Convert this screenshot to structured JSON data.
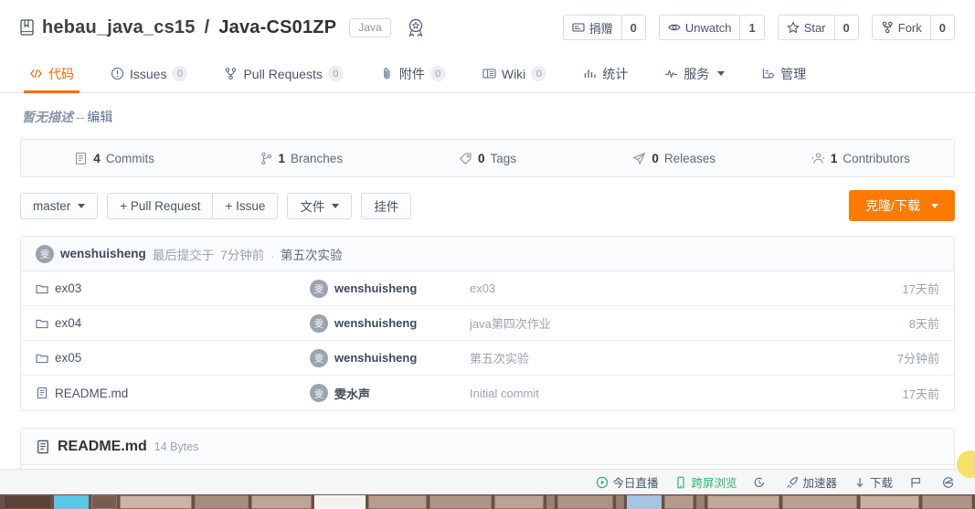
{
  "header": {
    "owner": "hebau_java_cs15",
    "separator": "/",
    "repo": "Java-CS01ZP",
    "language_badge": "Java",
    "medal_icon": "medal-icon",
    "book_icon": "repo-book-icon",
    "actions": [
      {
        "icon": "donate-icon",
        "label": "捐赠",
        "count": "0"
      },
      {
        "icon": "eye-icon",
        "label": "Unwatch",
        "count": "1"
      },
      {
        "icon": "star-icon",
        "label": "Star",
        "count": "0"
      },
      {
        "icon": "fork-icon",
        "label": "Fork",
        "count": "0"
      }
    ]
  },
  "nav": {
    "tabs": [
      {
        "icon": "code-icon",
        "label": "代码",
        "count": null,
        "active": true,
        "caret": false
      },
      {
        "icon": "issue-icon",
        "label": "Issues",
        "count": "0",
        "active": false,
        "caret": false
      },
      {
        "icon": "pull-request-icon",
        "label": "Pull Requests",
        "count": "0",
        "active": false,
        "caret": false
      },
      {
        "icon": "attachment-icon",
        "label": "附件",
        "count": "0",
        "active": false,
        "caret": false
      },
      {
        "icon": "wiki-icon",
        "label": "Wiki",
        "count": "0",
        "active": false,
        "caret": false
      },
      {
        "icon": "stats-icon",
        "label": "统计",
        "count": null,
        "active": false,
        "caret": false
      },
      {
        "icon": "service-icon",
        "label": "服务",
        "count": null,
        "active": false,
        "caret": true
      },
      {
        "icon": "manage-icon",
        "label": "管理",
        "count": null,
        "active": false,
        "caret": false
      }
    ]
  },
  "description": {
    "text": "暂无描述",
    "dash": "--",
    "edit_label": "编辑"
  },
  "stats": [
    {
      "icon": "commit-icon",
      "value": "4",
      "label": "Commits"
    },
    {
      "icon": "branch-icon",
      "value": "1",
      "label": "Branches"
    },
    {
      "icon": "tag-icon",
      "value": "0",
      "label": "Tags"
    },
    {
      "icon": "release-icon",
      "value": "0",
      "label": "Releases"
    },
    {
      "icon": "contributors-icon",
      "value": "1",
      "label": "Contributors"
    }
  ],
  "toolbar": {
    "branch_label": "master",
    "pull_request_label": "+ Pull Request",
    "issue_label": "+ Issue",
    "files_label": "文件",
    "widget_label": "挂件",
    "clone_label": "克隆/下载"
  },
  "last_commit": {
    "avatar_text": "雯",
    "author": "wenshuisheng",
    "meta": "最后提交于",
    "time": "7分钟前",
    "dot": ".",
    "message": "第五次实验"
  },
  "files": [
    {
      "icon": "folder-icon",
      "name": "ex03",
      "avatar_text": "雯",
      "author": "wenshuisheng",
      "message": "ex03",
      "time": "17天前"
    },
    {
      "icon": "folder-icon",
      "name": "ex04",
      "avatar_text": "雯",
      "author": "wenshuisheng",
      "message": "java第四次作业",
      "time": "8天前"
    },
    {
      "icon": "folder-icon",
      "name": "ex05",
      "avatar_text": "雯",
      "author": "wenshuisheng",
      "message": "第五次实验",
      "time": "7分钟前"
    },
    {
      "icon": "file-icon",
      "name": "README.md",
      "avatar_text": "雯",
      "author": "雯水声",
      "message": "Initial commit",
      "time": "17天前"
    }
  ],
  "readme": {
    "icon": "readme-file-icon",
    "title": "README.md",
    "size": "14 Bytes"
  },
  "statusbar": {
    "items": [
      {
        "icon": "play-circle-icon",
        "label": "今日直播",
        "accent": true
      },
      {
        "icon": "phone-icon",
        "label": "跨屏浏览",
        "accent": true
      },
      {
        "icon": "history-icon",
        "label": "",
        "accent": false
      },
      {
        "icon": "rocket-icon",
        "label": "加速器",
        "accent": false
      },
      {
        "icon": "download-arrow-icon",
        "label": "下载",
        "accent": false
      },
      {
        "icon": "flag-icon",
        "label": "",
        "accent": false
      },
      {
        "icon": "browser-e-icon",
        "label": "",
        "accent": false
      }
    ]
  },
  "colors": {
    "accent_orange": "#ff6a00",
    "clone_button": "#ff7a00",
    "border": "#e4e7ed",
    "muted_text": "#9aa3b0",
    "status_green": "#2bb673"
  }
}
